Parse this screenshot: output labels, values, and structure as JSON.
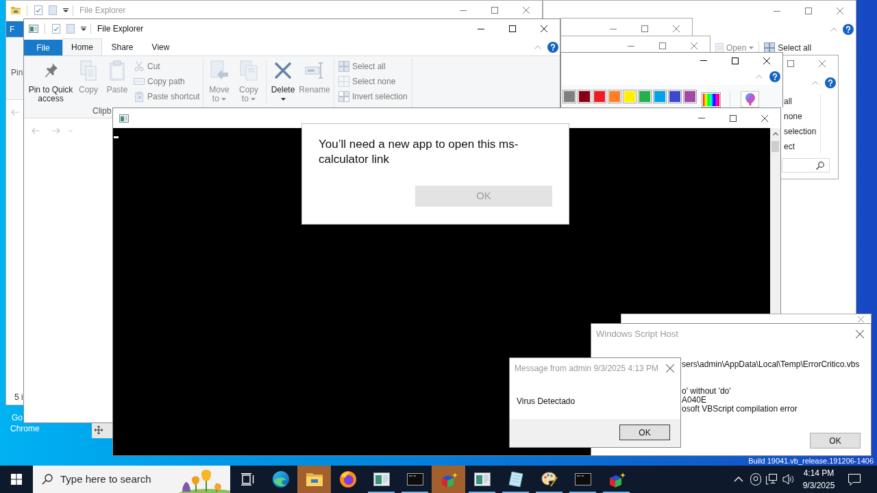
{
  "desktop": {
    "icon_label_lines": [
      "Go",
      "Chrome"
    ],
    "build_text": "Build 19041.vb_release.191206-1406"
  },
  "explorer_back": {
    "title": "File Explorer",
    "file_tab": "F",
    "ribbon_fragment": "Pin",
    "status_fragment": "5 i"
  },
  "explorer_right": {
    "commands": [
      {
        "label": "Open",
        "disabled": true,
        "dropdown": true
      },
      {
        "label": "Select all",
        "disabled": false,
        "dropdown": false
      }
    ]
  },
  "selection_window": {
    "commands": [
      "all",
      "none",
      "selection",
      "ect"
    ]
  },
  "paint": {
    "palette": [
      {
        "color": "#7f7f7f"
      },
      {
        "color": "#880015"
      },
      {
        "color": "#ed1c24"
      },
      {
        "color": "#ff7f27"
      },
      {
        "color": "#fff200"
      },
      {
        "color": "#22b14c"
      },
      {
        "color": "#00a2e8"
      },
      {
        "color": "#3f48cc"
      },
      {
        "color": "#a349a4"
      }
    ]
  },
  "explorer_front": {
    "title": "File Explorer",
    "tabs": [
      {
        "label": "File",
        "kind": "backstage",
        "selected": false
      },
      {
        "label": "Home",
        "kind": "tab",
        "selected": true
      },
      {
        "label": "Share",
        "kind": "tab",
        "selected": false
      },
      {
        "label": "View",
        "kind": "tab",
        "selected": false
      }
    ],
    "ribbon": [
      {
        "label": "Clipb",
        "large": [
          {
            "label": "Pin to Quick access",
            "disabled": false,
            "dropdown": false
          },
          {
            "label": "Copy",
            "disabled": true,
            "dropdown": false
          },
          {
            "label": "Paste",
            "disabled": true,
            "dropdown": false
          }
        ],
        "small": [
          {
            "label": "Cut",
            "disabled": true
          },
          {
            "label": "Copy path",
            "disabled": true
          },
          {
            "label": "Paste shortcut",
            "disabled": true
          }
        ]
      },
      {
        "large": [
          {
            "label": "Move to",
            "disabled": true,
            "dropdown": true
          },
          {
            "label": "Copy to",
            "disabled": true,
            "dropdown": true
          },
          {
            "label": "Delete",
            "disabled": false,
            "dropdown": true
          },
          {
            "label": "Rename",
            "disabled": true,
            "dropdown": false
          }
        ]
      },
      {
        "small": [
          {
            "label": "Select all",
            "disabled": true
          },
          {
            "label": "Select none",
            "disabled": true
          },
          {
            "label": "Invert selection",
            "disabled": true
          }
        ]
      }
    ]
  },
  "app_dialog": {
    "message": "You’ll need a new app to open this ms-calculator link",
    "button": {
      "label": "OK",
      "disabled": true
    }
  },
  "script_host": {
    "title": "Windows Script Host",
    "path_line": "sers\\admin\\AppData\\Local\\Temp\\ErrorCritico.vbs",
    "detail_lines": [
      "o' without 'do'",
      "A040E",
      "osoft VBScript compilation error"
    ],
    "button": "OK"
  },
  "message_box": {
    "title": "Message from admin 9/3/2025 4:13 PM",
    "message": "Virus Detectado",
    "button": "OK"
  },
  "taskbar": {
    "search_placeholder": "Type here to search",
    "apps": [
      {
        "kind": "taskview",
        "running": false,
        "flashing": false
      },
      {
        "kind": "swirl",
        "running": false,
        "flashing": false
      },
      {
        "kind": "folder",
        "running": false,
        "flashing": true
      },
      {
        "kind": "flame",
        "running": false,
        "flashing": false
      },
      {
        "kind": "window",
        "running": true,
        "flashing": false
      },
      {
        "kind": "terminal",
        "running": true,
        "flashing": false
      },
      {
        "kind": "cube",
        "running": false,
        "flashing": true
      },
      {
        "kind": "window",
        "running": true,
        "flashing": false
      },
      {
        "kind": "sheet",
        "running": true,
        "flashing": false
      },
      {
        "kind": "palette",
        "running": true,
        "flashing": false
      },
      {
        "kind": "terminal",
        "running": true,
        "flashing": false
      },
      {
        "kind": "cube",
        "running": true,
        "flashing": false
      }
    ],
    "clock": {
      "time": "4:14 PM",
      "date": "9/3/2025"
    }
  }
}
